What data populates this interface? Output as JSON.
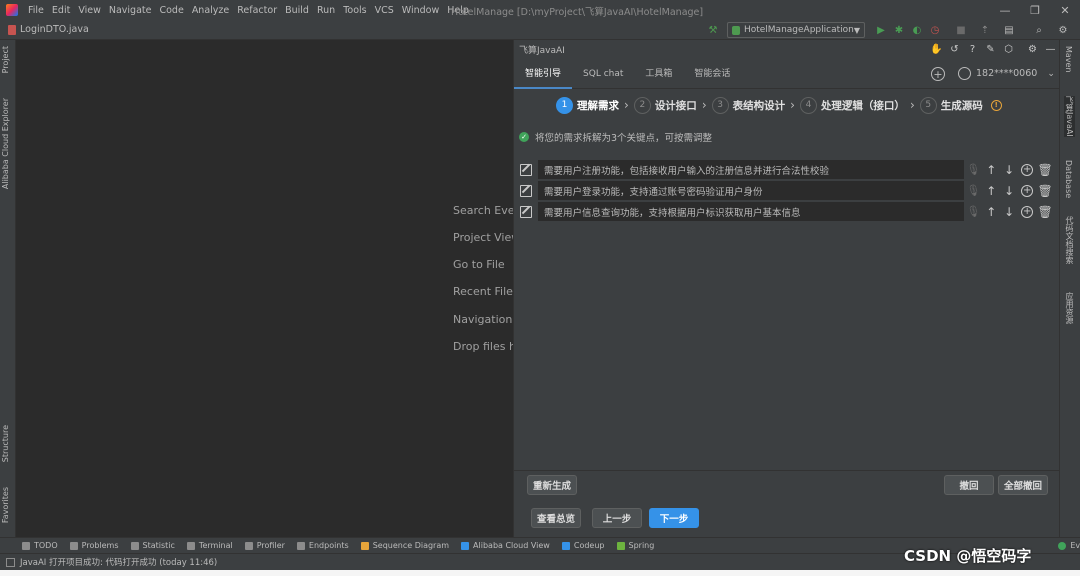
{
  "menu": {
    "items": [
      "File",
      "Edit",
      "View",
      "Navigate",
      "Code",
      "Analyze",
      "Refactor",
      "Build",
      "Run",
      "Tools",
      "VCS",
      "Window",
      "Help"
    ],
    "window_title": "HotelManage [D:\\myProject\\飞算JavaAI\\HotelManage]"
  },
  "nav": {
    "file": "LoginDTO.java",
    "run_config": "HotelManageApplication"
  },
  "left_tabs": [
    "Project",
    "Alibaba Cloud Explorer",
    "Structure",
    "Favorites"
  ],
  "right_tabs": [
    "Maven",
    "飞算JavaAI",
    "Database",
    "代码文档搜索",
    "应用资源"
  ],
  "editor": {
    "hints": [
      "Search Everywhere",
      "Project View",
      "Go to File",
      "Recent Files",
      "Navigation Bar",
      "Drop files here to open"
    ]
  },
  "panel": {
    "title": "飞算JavaAI",
    "tabs": [
      "智能引导",
      "SQL chat",
      "工具箱",
      "智能会话"
    ],
    "user": "182****0060",
    "steps": [
      {
        "num": "1",
        "label": "理解需求"
      },
      {
        "num": "2",
        "label": "设计接口"
      },
      {
        "num": "3",
        "label": "表结构设计"
      },
      {
        "num": "4",
        "label": "处理逻辑（接口）"
      },
      {
        "num": "5",
        "label": "生成源码"
      }
    ],
    "status": "将您的需求拆解为3个关键点，可按需调整",
    "requirements": [
      "需要用户注册功能，包括接收用户输入的注册信息并进行合法性校验",
      "需要用户登录功能，支持通过账号密码验证用户身份",
      "需要用户信息查询功能，支持根据用户标识获取用户基本信息"
    ],
    "buttons": {
      "regenerate": "重新生成",
      "undo": "撤回",
      "undo_all": "全部撤回",
      "overview": "查看总览",
      "prev": "上一步",
      "next": "下一步"
    }
  },
  "bottom_tools": [
    "TODO",
    "Problems",
    "Statistic",
    "Terminal",
    "Profiler",
    "Endpoints",
    "Sequence Diagram",
    "Alibaba Cloud View",
    "Codeup",
    "Spring",
    "Event Log"
  ],
  "statusbar": {
    "message": "JavaAI 打开项目成功: 代码打开成功 (today 11:46)",
    "watermark": "CSDN @悟空码字"
  }
}
